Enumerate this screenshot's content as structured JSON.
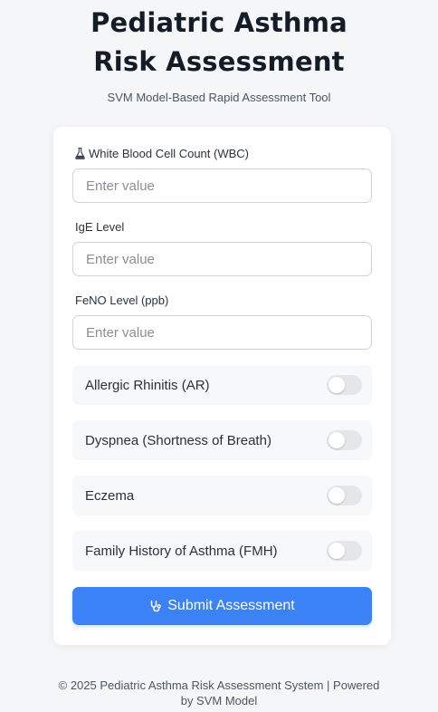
{
  "header": {
    "title": "Pediatric Asthma Risk Assessment",
    "subtitle": "SVM Model-Based Rapid Assessment Tool"
  },
  "form": {
    "fields": [
      {
        "label": "White Blood Cell Count (WBC)",
        "icon": "flask-icon",
        "placeholder": "Enter value",
        "value": ""
      },
      {
        "label": "IgE Level",
        "placeholder": "Enter value",
        "value": ""
      },
      {
        "label": "FeNO Level (ppb)",
        "placeholder": "Enter value",
        "value": ""
      }
    ],
    "toggles": [
      {
        "label": "Allergic Rhinitis (AR)",
        "checked": false
      },
      {
        "label": "Dyspnea (Shortness of Breath)",
        "checked": false
      },
      {
        "label": "Eczema",
        "checked": false
      },
      {
        "label": "Family History of Asthma (FMH)",
        "checked": false
      }
    ],
    "submit": {
      "label": "Submit Assessment",
      "icon": "stethoscope-icon"
    }
  },
  "footer": {
    "line1": "© 2025 Pediatric Asthma Risk Assessment System | Powered",
    "line2": "by SVM Model"
  },
  "colors": {
    "accent": "#3b82f6",
    "background": "#f5f6f8",
    "card": "#ffffff"
  }
}
